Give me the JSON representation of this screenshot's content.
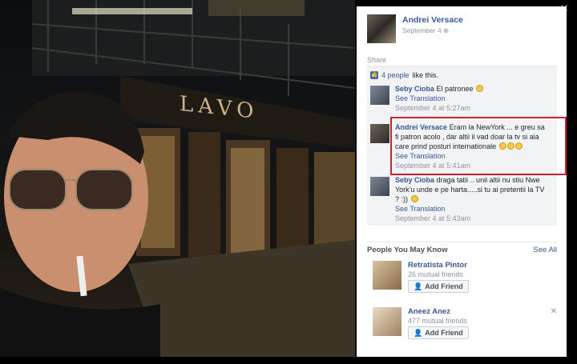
{
  "post": {
    "author": "Andrei Versace",
    "date": "September 4",
    "share": "Share",
    "likes_count": "4 people",
    "likes_suffix": "like this.",
    "photo_sign": "LAVO"
  },
  "comments": [
    {
      "author": "Seby Cioba",
      "text": "El patronee",
      "translation": "See Translation",
      "time": "September 4 at 5:27am"
    },
    {
      "author": "Andrei Versace",
      "text": "Eram la NewYork ... e greu sa fi patron acolo , dar altii il vad doar la tv si aia care prind posturi internationale",
      "translation": "See Translation",
      "time": "September 4 at 5:41am"
    },
    {
      "author": "Seby Cioba",
      "text": "draga tatii .. unii altii nu stiu Nwe York'u unde e pe harta.....si tu ai pretentii la TV ? :))",
      "translation": "See Translation",
      "time": "September 4 at 5:43am"
    }
  ],
  "pymk": {
    "title": "People You May Know",
    "see_all": "See All",
    "people": [
      {
        "name": "Retratista Pintor",
        "mutual": "26 mutual friends",
        "button": "Add Friend"
      },
      {
        "name": "Aneez Anez",
        "mutual": "477 mutual friends",
        "button": "Add Friend"
      }
    ]
  },
  "colors": {
    "link": "#365899",
    "highlight": "#d0202e",
    "meta": "#90949c"
  }
}
